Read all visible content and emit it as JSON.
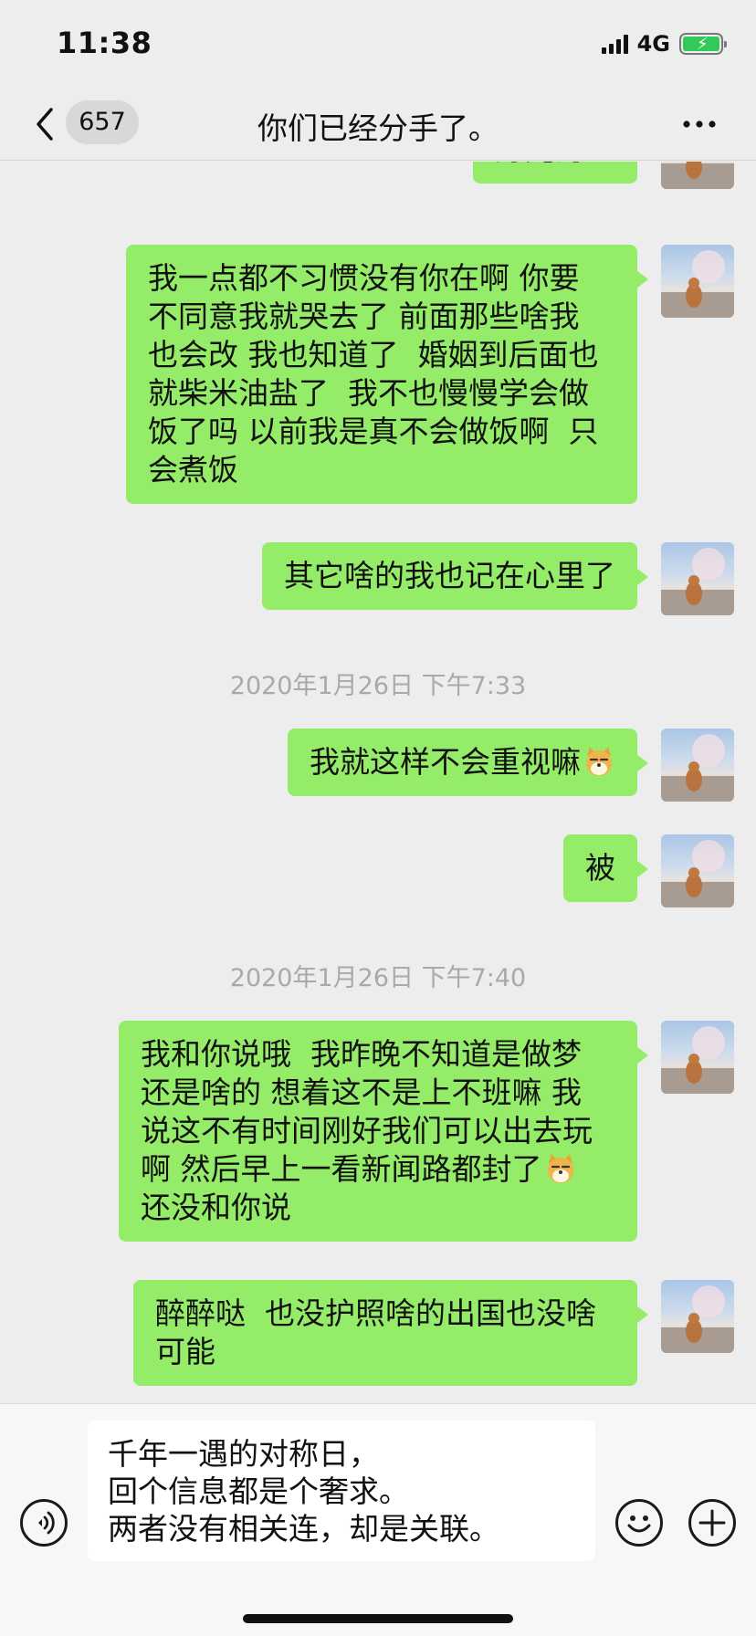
{
  "status_bar": {
    "time": "11:38",
    "network": "4G"
  },
  "nav": {
    "unread_count": "657",
    "title": "你们已经分手了。",
    "more_icon": "more-icon"
  },
  "messages": [
    {
      "lines": [
        "灯光为证"
      ]
    },
    {
      "lines": [
        "我一点都不习惯没有你在啊 你要",
        "不同意我就哭去了 前面那些啥我",
        "也会改 我也知道了  婚姻到后面也",
        "就柴米油盐了  我不也慢慢学会做",
        "饭了吗 以前我是真不会做饭啊  只",
        "会煮饭"
      ]
    },
    {
      "lines": [
        "其它啥的我也记在心里了"
      ]
    },
    {
      "lines": [
        "我就这样不会重视嘛"
      ],
      "emoji": "doge-emoji"
    },
    {
      "lines": [
        "被"
      ]
    },
    {
      "lines": [
        "我和你说哦  我昨晚不知道是做梦",
        "还是啥的 想着这不是上不班嘛 我",
        "说这不有时间刚好我们可以出去玩",
        "啊 然后早上一看新闻路都封了",
        "还没和你说"
      ],
      "emoji_line": 3,
      "emoji": "doge-emoji"
    },
    {
      "lines": [
        "醉醉哒  也没护照啥的出国也没啥",
        "可能"
      ]
    }
  ],
  "timestamps": [
    "2020年1月26日 下午7:33",
    "2020年1月26日 下午7:40"
  ],
  "input": {
    "lines": [
      "千年一遇的对称日，",
      "回个信息都是个奢求。",
      "两者没有相关连，却是关联。"
    ]
  },
  "colors": {
    "bubble": "#95ec69",
    "background": "#ededed",
    "timestamp": "#a9a9a9",
    "battery": "#32c85a"
  }
}
